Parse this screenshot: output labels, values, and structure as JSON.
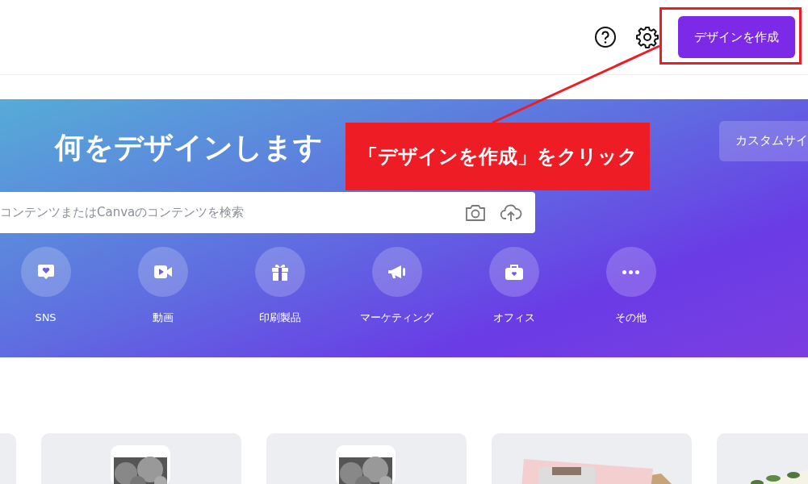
{
  "header": {
    "create_button": "デザインを作成"
  },
  "hero": {
    "title": "何をデザインします",
    "custom_size_button": "カスタムサイ",
    "search": {
      "placeholder": "コンテンツまたはCanvaのコンテンツを検索"
    },
    "categories": [
      {
        "kind": "sns",
        "label": "SNS"
      },
      {
        "kind": "video",
        "label": "動画"
      },
      {
        "kind": "print",
        "label": "印刷製品"
      },
      {
        "kind": "marketing",
        "label": "マーケティング"
      },
      {
        "kind": "office",
        "label": "オフィス"
      },
      {
        "kind": "more",
        "label": "その他"
      }
    ]
  },
  "annotation": {
    "text": "「デザインを作成」をクリック"
  }
}
